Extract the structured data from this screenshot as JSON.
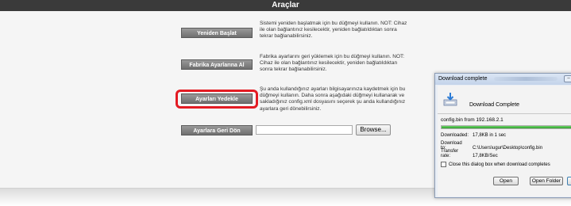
{
  "panel": {
    "title": "Araçlar"
  },
  "tools": [
    {
      "button": "Yeniden Başlat",
      "desc": "Sistemi yeniden başlatmak için bu düğmeyi kullanın. NOT: Cihaz ile olan bağlantınız kesilecektir, yeniden bağlatıldıktan sonra tekrar bağlanabilirsiniz."
    },
    {
      "button": "Fabrika Ayarlarına Al",
      "desc": "Fabrika ayarlarını geri yüklemek için bu düğmeyi kullanın. NOT: Cihaz ile olan bağlantınız kesilecektir, yeniden bağlatıldıktan sonra tekrar bağlanabilirsiniz."
    },
    {
      "button": "Ayarları Yedekle",
      "desc": "Şu anda kullandığınız ayarları bilgisayarınıza kaydetmek için bu düğmeyi kullanın. Daha sonra aşağıdaki düğmeyi kullanarak ve sakladığınız config.xml dosyasını seçerek şu anda kullandığınız ayarlara geri dönebilirsiniz."
    },
    {
      "button": "Ayarlara Geri Dön",
      "file_value": "",
      "browse": "Browse..."
    }
  ],
  "dialog": {
    "title": "Download complete",
    "heading": "Download Complete",
    "from": "config.bin from 192.168.2.1",
    "progress": 1.0,
    "rows": [
      {
        "label": "Downloaded:",
        "value": "17,8KB in 1 sec"
      },
      {
        "label": "Download to:",
        "value": "C:\\Users\\ugur\\Desktop\\config.bin"
      },
      {
        "label": "Transfer rate:",
        "value": "17,8KB/Sec"
      }
    ],
    "checkbox_label": "Close this dialog box when download completes",
    "open_button": "Open",
    "open_folder_button": "Open Folder"
  }
}
